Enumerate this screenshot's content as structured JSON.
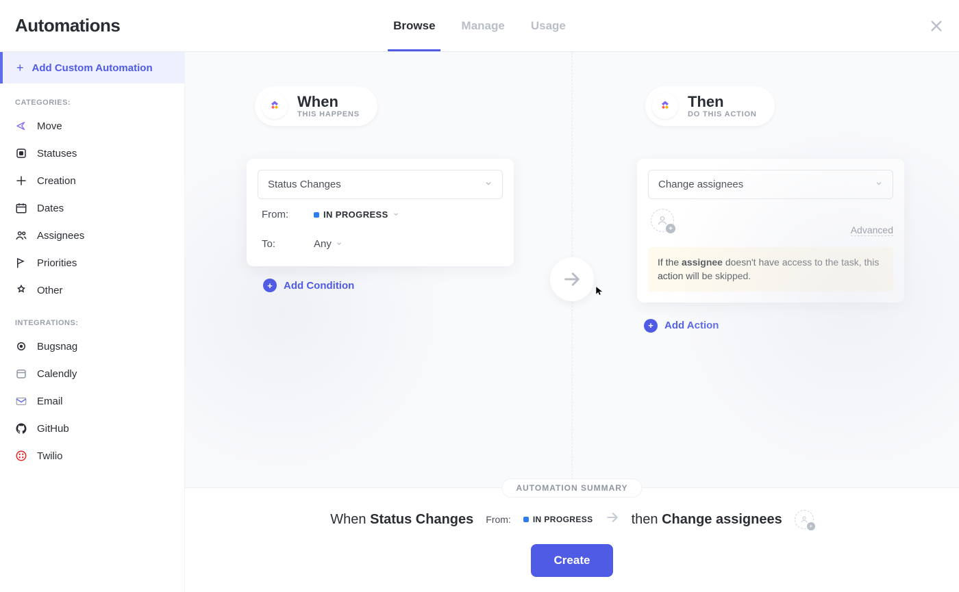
{
  "header": {
    "title": "Automations",
    "tabs": [
      "Browse",
      "Manage",
      "Usage"
    ],
    "active_tab": 0
  },
  "sidebar": {
    "add_custom_label": "Add Custom Automation",
    "categories_label": "CATEGORIES:",
    "categories": [
      {
        "label": "Move"
      },
      {
        "label": "Statuses"
      },
      {
        "label": "Creation"
      },
      {
        "label": "Dates"
      },
      {
        "label": "Assignees"
      },
      {
        "label": "Priorities"
      },
      {
        "label": "Other"
      }
    ],
    "integrations_label": "INTEGRATIONS:",
    "integrations": [
      {
        "label": "Bugsnag"
      },
      {
        "label": "Calendly"
      },
      {
        "label": "Email"
      },
      {
        "label": "GitHub"
      },
      {
        "label": "Twilio"
      }
    ]
  },
  "builder": {
    "when": {
      "title": "When",
      "subtitle": "THIS HAPPENS",
      "trigger_select": "Status Changes",
      "from_label": "From:",
      "from_value": "IN PROGRESS",
      "to_label": "To:",
      "to_value": "Any",
      "add_condition_label": "Add Condition"
    },
    "then": {
      "title": "Then",
      "subtitle": "DO THIS ACTION",
      "action_select": "Change assignees",
      "advanced_label": "Advanced",
      "warning_prefix": "If the ",
      "warning_bold": "assignee",
      "warning_suffix": " doesn't have access to the task, this action will be skipped.",
      "add_action_label": "Add Action"
    }
  },
  "summary": {
    "badge": "AUTOMATION SUMMARY",
    "when_word": "When",
    "when_strong": "Status Changes",
    "from_label": "From:",
    "from_status": "IN PROGRESS",
    "then_word": "then",
    "then_strong": "Change assignees",
    "create_label": "Create"
  }
}
